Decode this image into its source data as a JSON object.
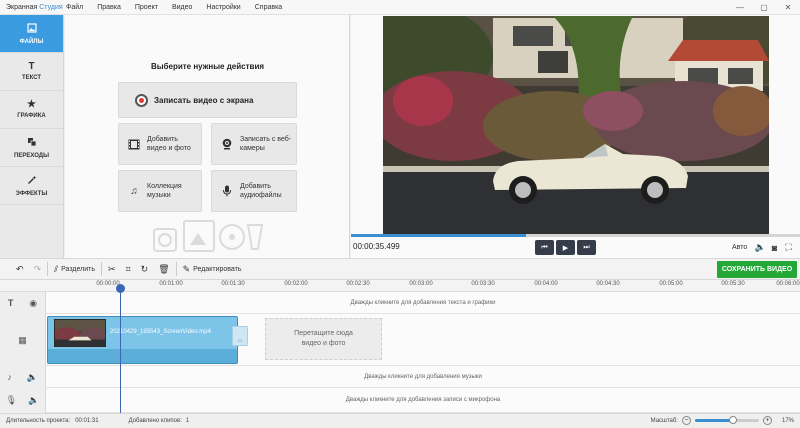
{
  "app": {
    "brand_part1": "Экранная ",
    "brand_part2": "Студия"
  },
  "menu": [
    "Файл",
    "Правка",
    "Проект",
    "Видео",
    "Настройки",
    "Справка"
  ],
  "window_controls": [
    "—",
    "▢",
    "✕"
  ],
  "sidebar": {
    "items": [
      {
        "label": "ФАЙЛЫ",
        "icon": "files-icon",
        "active": true
      },
      {
        "label": "ТЕКСТ",
        "icon": "text-icon",
        "active": false
      },
      {
        "label": "ГРАФИКА",
        "icon": "star-icon",
        "active": false
      },
      {
        "label": "ПЕРЕХОДЫ",
        "icon": "transitions-icon",
        "active": false
      },
      {
        "label": "ЭФФЕКТЫ",
        "icon": "magic-wand-icon",
        "active": false
      }
    ]
  },
  "actions": {
    "title": "Выберите нужные действия",
    "record": "Записать видео с экрана",
    "add_video": "Добавить видео и фото",
    "webcam": "Записать с веб-камеры",
    "music": "Коллекция музыки",
    "audio": "Добавить аудиофайлы"
  },
  "preview": {
    "timecode": "00:00:35.499",
    "progress_fraction": 0.39,
    "quality": "Авто"
  },
  "toolbar": {
    "split": "Разделить",
    "edit": "Редактировать",
    "save": "СОХРАНИТЬ ВИДЕО"
  },
  "ruler": {
    "ticks": [
      "00:00:00",
      "00:01:00",
      "00:01:30",
      "00:02:00",
      "00:02:30",
      "00:03:00",
      "00:03:30",
      "00:04:00",
      "00:04:30",
      "00:05:00",
      "00:05:30",
      "00:06:00"
    ]
  },
  "timeline": {
    "text_track_hint": "Дважды кликните для добавления текста и графики",
    "clip_name": "20210429_195543_ScreenVideo.mp4",
    "drop_zone": "Перетащите сюда видео и фото",
    "music_track_hint": "Дважды кликните для добавления музыки",
    "mic_track_hint": "Дважды кликните для добавления записи с микрофона"
  },
  "status": {
    "duration_label": "Длительность проекта:",
    "duration_value": "00:01:31",
    "clips_label": "Добавлено клипов:",
    "clips_value": "1",
    "zoom_label": "Масштаб:",
    "zoom_value": "17%",
    "zoom_fraction": 0.6
  },
  "colors": {
    "accent": "#3a9be0",
    "save_button": "#23a838",
    "playhead": "#3a67b5",
    "clip": "#7cc4e8"
  }
}
